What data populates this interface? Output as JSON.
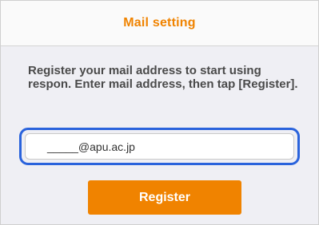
{
  "header": {
    "title": "Mail setting"
  },
  "main": {
    "instructions": "Register your mail address to start using respon. Enter mail address, then tap [Register].",
    "mail_input": {
      "value": "_____@apu.ac.jp"
    },
    "register_label": "Register"
  },
  "colors": {
    "accent": "#f08300",
    "highlight": "#2a63dc",
    "background": "#efeff4",
    "text": "#4a4a4a"
  }
}
